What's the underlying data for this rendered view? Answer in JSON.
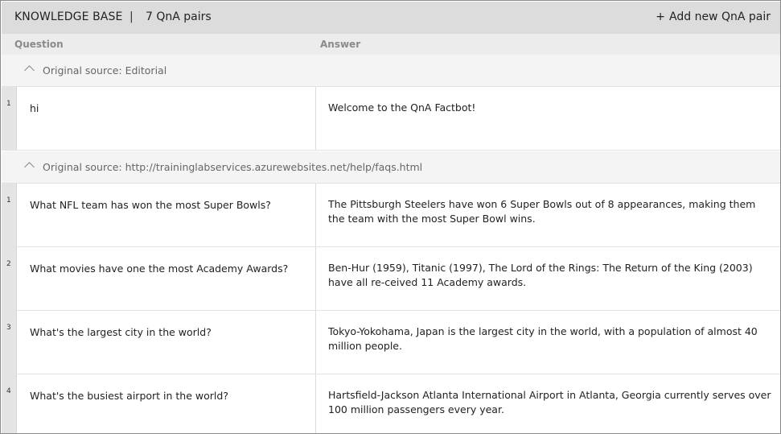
{
  "header": {
    "title": "KNOWLEDGE BASE",
    "separator": "|",
    "count": "7 QnA pairs",
    "add_icon": "plus-icon",
    "add_symbol": "+",
    "add_label": "Add new QnA pair"
  },
  "columns": {
    "question": "Question",
    "answer": "Answer"
  },
  "sections": [
    {
      "source": "Original source: Editorial",
      "chevron_icon": "chevron-up-icon",
      "rows": [
        {
          "num": "1",
          "question": "hi",
          "answer": "Welcome to the QnA Factbot!"
        }
      ]
    },
    {
      "source": "Original source: http://traininglabservices.azurewebsites.net/help/faqs.html",
      "chevron_icon": "chevron-up-icon",
      "rows": [
        {
          "num": "1",
          "question": "What NFL team has won the most Super Bowls?",
          "answer": "The Pittsburgh Steelers have won 6 Super Bowls out of 8 appearances, making them the team with the most Super Bowl wins."
        },
        {
          "num": "2",
          "question": "What movies have one the most Academy Awards?",
          "answer": "Ben-Hur (1959), Titanic (1997), The Lord of the Rings: The Return of the King (2003) have all re-ceived 11 Academy awards."
        },
        {
          "num": "3",
          "question": "What's the largest city in the world?",
          "answer": "Tokyo-Yokohama, Japan is the largest city in the world, with a population of almost 40 million people."
        },
        {
          "num": "4",
          "question": "What's the busiest airport in the world?",
          "answer": "Hartsfield-Jackson Atlanta International Airport in Atlanta, Georgia currently serves over 100 million passengers every year."
        }
      ]
    }
  ]
}
